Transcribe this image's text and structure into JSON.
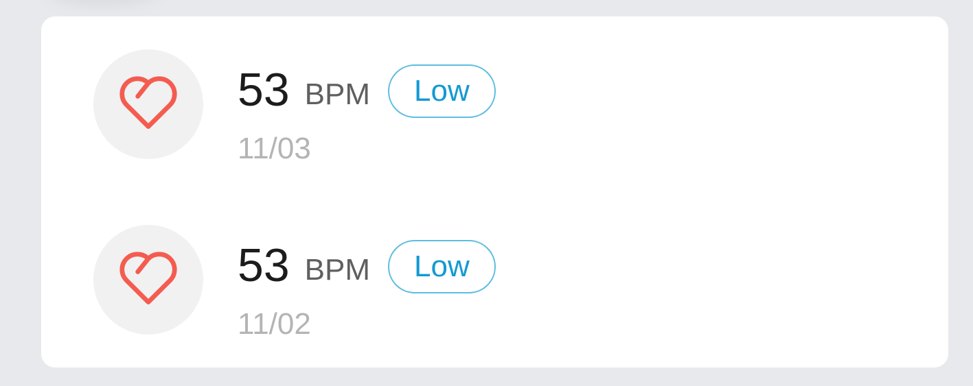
{
  "colors": {
    "background": "#e8e9ed",
    "card": "#ffffff",
    "heart_icon": "#f45c4f",
    "badge_text": "#139ad2",
    "badge_border": "#5dbde0",
    "date_text": "#b4b4b4"
  },
  "records": [
    {
      "icon": "heart-icon",
      "value": "53",
      "unit": "BPM",
      "status": "Low",
      "date": "11/03"
    },
    {
      "icon": "heart-icon",
      "value": "53",
      "unit": "BPM",
      "status": "Low",
      "date": "11/02"
    }
  ]
}
